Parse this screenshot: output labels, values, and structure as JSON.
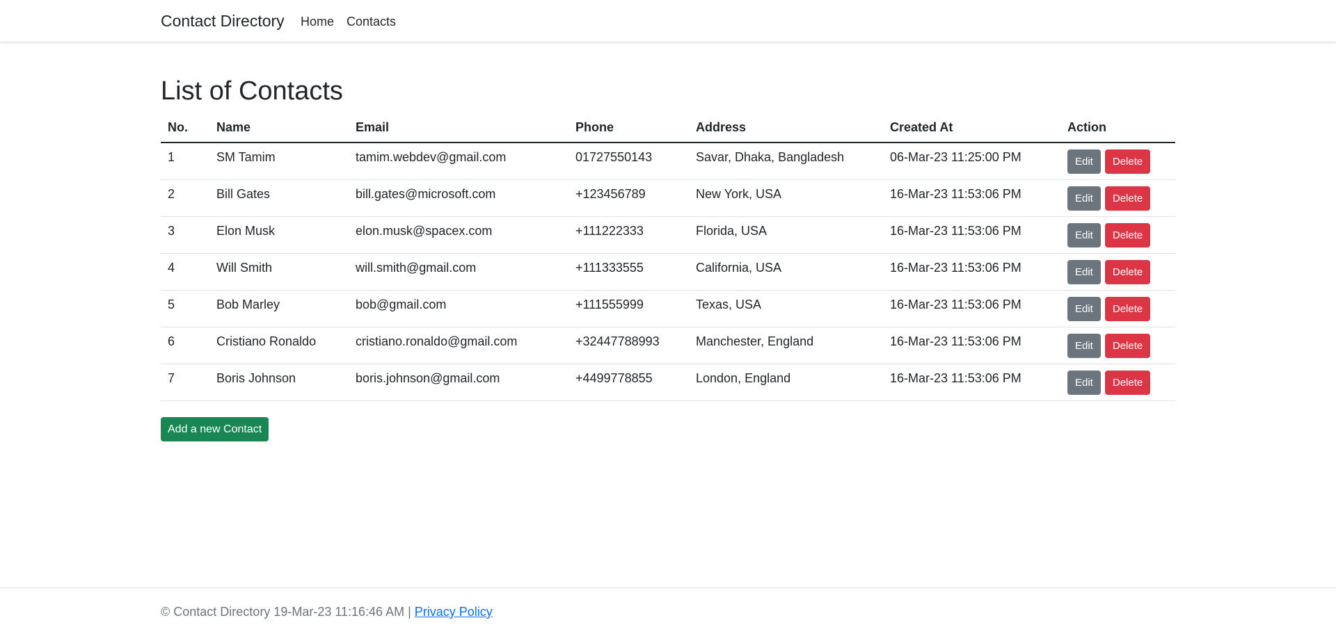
{
  "navbar": {
    "brand": "Contact Directory",
    "links": [
      {
        "label": "Home"
      },
      {
        "label": "Contacts"
      }
    ]
  },
  "page": {
    "title": "List of Contacts"
  },
  "table": {
    "headers": [
      "No.",
      "Name",
      "Email",
      "Phone",
      "Address",
      "Created At",
      "Action"
    ],
    "rows": [
      {
        "no": "1",
        "name": "SM Tamim",
        "email": "tamim.webdev@gmail.com",
        "phone": "01727550143",
        "address": "Savar, Dhaka, Bangladesh",
        "created_at": "06-Mar-23 11:25:00 PM"
      },
      {
        "no": "2",
        "name": "Bill Gates",
        "email": "bill.gates@microsoft.com",
        "phone": "+123456789",
        "address": "New York, USA",
        "created_at": "16-Mar-23 11:53:06 PM"
      },
      {
        "no": "3",
        "name": "Elon Musk",
        "email": "elon.musk@spacex.com",
        "phone": "+111222333",
        "address": "Florida, USA",
        "created_at": "16-Mar-23 11:53:06 PM"
      },
      {
        "no": "4",
        "name": "Will Smith",
        "email": "will.smith@gmail.com",
        "phone": "+111333555",
        "address": "California, USA",
        "created_at": "16-Mar-23 11:53:06 PM"
      },
      {
        "no": "5",
        "name": "Bob Marley",
        "email": "bob@gmail.com",
        "phone": "+111555999",
        "address": "Texas, USA",
        "created_at": "16-Mar-23 11:53:06 PM"
      },
      {
        "no": "6",
        "name": "Cristiano Ronaldo",
        "email": "cristiano.ronaldo@gmail.com",
        "phone": "+32447788993",
        "address": "Manchester, England",
        "created_at": "16-Mar-23 11:53:06 PM"
      },
      {
        "no": "7",
        "name": "Boris Johnson",
        "email": "boris.johnson@gmail.com",
        "phone": "+4499778855",
        "address": "London, England",
        "created_at": "16-Mar-23 11:53:06 PM"
      }
    ],
    "edit_label": "Edit",
    "delete_label": "Delete"
  },
  "add_button": {
    "label": "Add a new Contact"
  },
  "footer": {
    "text": "© Contact Directory 19-Mar-23 11:16:46 AM |",
    "link_label": "Privacy Policy"
  },
  "colors": {
    "edit_button": "#6c757d",
    "delete_button": "#dc3545",
    "add_button": "#198754",
    "link": "#0d6efd"
  }
}
